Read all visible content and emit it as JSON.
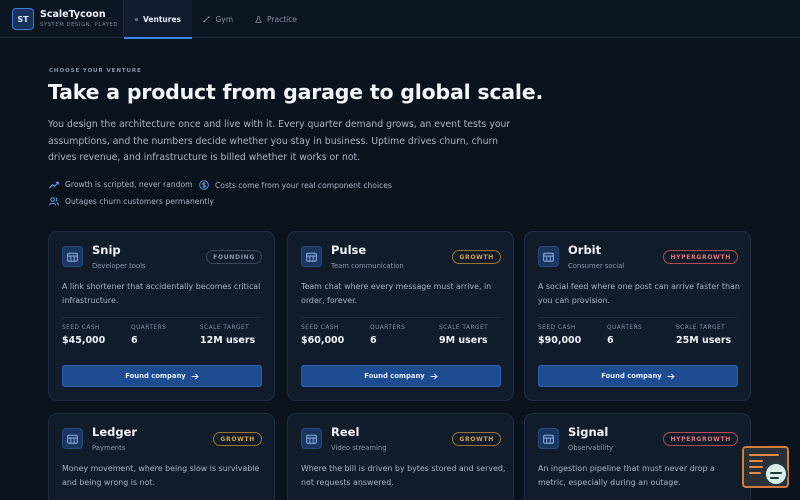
{
  "app": {
    "logo_initials": "ST",
    "name": "ScaleTycoon",
    "tagline": "SYSTEM DESIGN, PLAYED"
  },
  "nav": {
    "tabs": [
      {
        "label": "Ventures",
        "icon": "building-icon",
        "active": true
      },
      {
        "label": "Gym",
        "icon": "dumbbell-icon",
        "active": false
      },
      {
        "label": "Practice",
        "icon": "flask-icon",
        "active": false
      }
    ]
  },
  "hero": {
    "eyebrow": "CHOOSE YOUR VENTURE",
    "title": "Take a product from garage to global scale.",
    "lede": "You design the architecture once and live with it. Every quarter demand grows, an event tests your assumptions, and the numbers decide whether you stay in business. Uptime drives churn, churn drives revenue, and infrastructure is billed whether it works or not.",
    "features": [
      {
        "icon": "trend-up-icon",
        "text": "Growth is scripted, never random"
      },
      {
        "icon": "dollar-icon",
        "text": "Costs come from your real component choices"
      },
      {
        "icon": "users-icon",
        "text": "Outages churn customers permanently"
      }
    ]
  },
  "cards": [
    {
      "name": "Snip",
      "category": "Developer tools",
      "tier": "FOUNDING",
      "description": "A link shortener that accidentally becomes critical infrastructure.",
      "seed_cash": "$45,000",
      "quarters": "6",
      "scale_target": "12M users"
    },
    {
      "name": "Pulse",
      "category": "Team communication",
      "tier": "GROWTH",
      "description": "Team chat where every message must arrive, in order, forever.",
      "seed_cash": "$60,000",
      "quarters": "6",
      "scale_target": "9M users"
    },
    {
      "name": "Orbit",
      "category": "Consumer social",
      "tier": "HYPERGROWTH",
      "description": "A social feed where one post can arrive faster than you can provision.",
      "seed_cash": "$90,000",
      "quarters": "6",
      "scale_target": "25M users"
    },
    {
      "name": "Ledger",
      "category": "Payments",
      "tier": "GROWTH",
      "description": "Money movement, where being slow is survivable and being wrong is not."
    },
    {
      "name": "Reel",
      "category": "Video streaming",
      "tier": "GROWTH",
      "description": "Where the bill is driven by bytes stored and served, not requests answered."
    },
    {
      "name": "Signal",
      "category": "Observability",
      "tier": "HYPERGROWTH",
      "description": "An ingestion pipeline that must never drop a metric, especially during an outage."
    }
  ],
  "labels": {
    "seed_cash": "SEED CASH",
    "quarters": "QUARTERS",
    "scale_target": "SCALE TARGET",
    "cta": "Found company"
  },
  "colors": {
    "accent": "#3e86ef",
    "button": "#1c4c8f",
    "tier_founding": "#8a96a6",
    "tier_growth": "#d2a24a",
    "tier_hypergrowth": "#e2737b"
  }
}
